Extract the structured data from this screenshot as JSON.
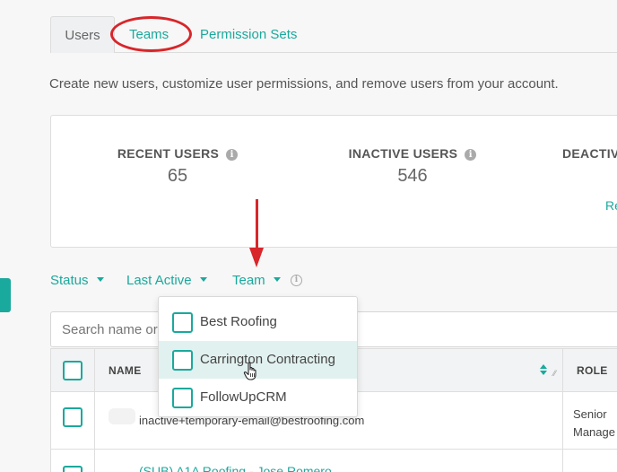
{
  "tabs": [
    {
      "label": "Users"
    },
    {
      "label": "Teams"
    },
    {
      "label": "Permission Sets"
    }
  ],
  "description": "Create new users, customize user permissions, and remove users from your account.",
  "stats": [
    {
      "label": "RECENT USERS",
      "value": "65"
    },
    {
      "label": "INACTIVE USERS",
      "value": "546"
    },
    {
      "label": "DEACTIV"
    }
  ],
  "stats_link": "Re",
  "filters": [
    {
      "label": "Status"
    },
    {
      "label": "Last Active"
    },
    {
      "label": "Team"
    }
  ],
  "search": {
    "placeholder": "Search name or"
  },
  "table": {
    "columns": [
      "NAME",
      "ROLE"
    ],
    "rows": [
      {
        "email": "inactive+temporary-email@bestroofing.com",
        "role_line1": "Senior",
        "role_line2": "Manage"
      },
      {
        "name": "(SUB) A1A Roofing - Jose Romero"
      }
    ]
  },
  "team_dropdown": {
    "options": [
      {
        "label": "Best Roofing"
      },
      {
        "label": "Carrington Contracting"
      },
      {
        "label": "FollowUpCRM"
      }
    ]
  },
  "colors": {
    "accent": "#1aa99d",
    "annotation": "#d8262a"
  }
}
